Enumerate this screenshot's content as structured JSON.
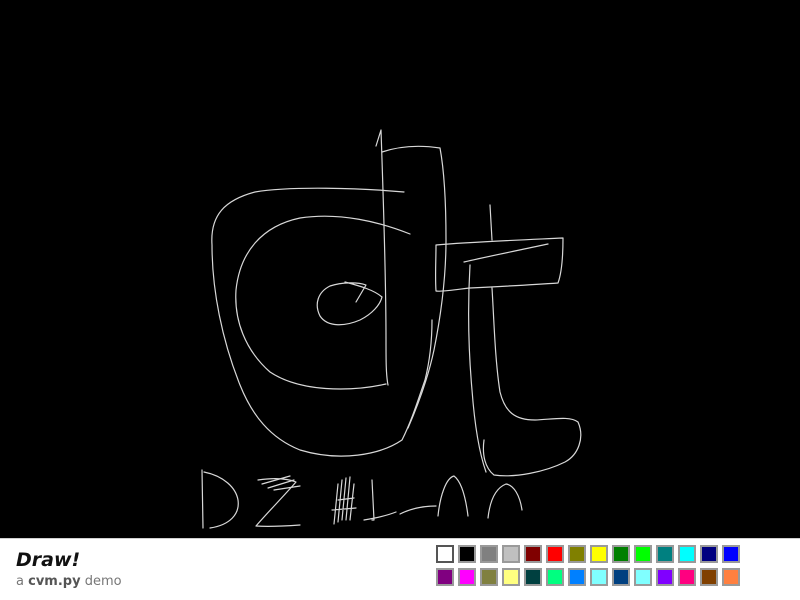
{
  "app": {
    "title": "Draw!",
    "subtitle_prefix": "a ",
    "subtitle_lib": "cvm.py",
    "subtitle_suffix": " demo"
  },
  "canvas": {
    "background": "#000000",
    "stroke_color": "#d8d8d8"
  },
  "palette": {
    "selected_index": 0,
    "colors": [
      "#ffffff",
      "#000000",
      "#808080",
      "#c0c0c0",
      "#800000",
      "#ff0000",
      "#808000",
      "#ffff00",
      "#008000",
      "#00ff00",
      "#008080",
      "#00ffff",
      "#000080",
      "#0000ff",
      "#800080",
      "#ff00ff",
      "#808040",
      "#ffff80",
      "#004040",
      "#00ff80",
      "#0080ff",
      "#80ffff",
      "#004080",
      "#80ffff",
      "#8000ff",
      "#ff0080",
      "#804000",
      "#ff8040"
    ]
  }
}
